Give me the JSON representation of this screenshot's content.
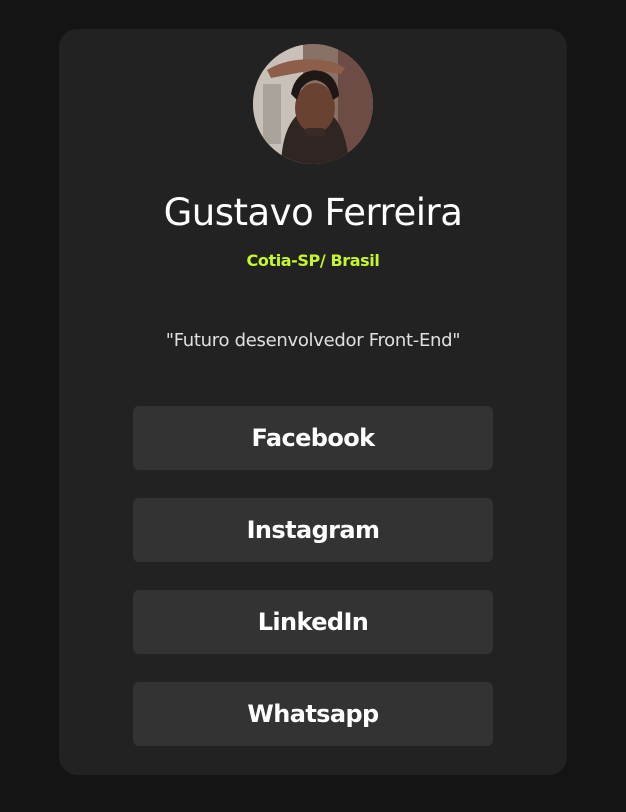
{
  "profile": {
    "name": "Gustavo Ferreira",
    "location": "Cotia-SP/ Brasil",
    "bio": "\"Futuro desenvolvedor Front-End\""
  },
  "links": [
    {
      "label": "Facebook"
    },
    {
      "label": "Instagram"
    },
    {
      "label": "LinkedIn"
    },
    {
      "label": "Whatsapp"
    }
  ],
  "colors": {
    "background": "#141414",
    "card": "#222222",
    "button": "#333333",
    "accent": "#c5f82a",
    "text": "#ffffff"
  }
}
